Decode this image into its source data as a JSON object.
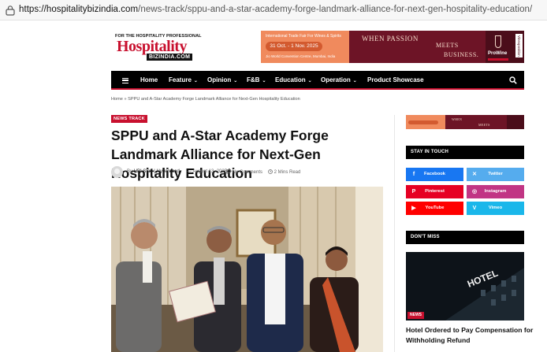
{
  "browser": {
    "url_domain": "https://hospitalitybizindia.com",
    "url_path": "/news-track/sppu-and-a-star-academy-forge-landmark-alliance-for-next-gen-hospitality-education/"
  },
  "header": {
    "logo_tagline": "FOR THE HOSPITALITY PROFESSIONAL",
    "logo_brand": "Hospitality",
    "logo_biz": "BIZINDIA.COM",
    "ad": {
      "event": "International Trade Fair For Wines & Spirits",
      "dates": "31 Oct. - 1 Nov. 2025",
      "venue": "Jio World Convention Centre, Mumbai, India",
      "word1": "WHEN",
      "word2": "PASSION",
      "word3": "MEETS",
      "word4": "BUSINESS.",
      "sponsor": "ProWine",
      "sponsor_region": "Mumbai",
      "vertical": "Vinexposition"
    }
  },
  "nav": {
    "items": [
      {
        "label": "Home",
        "has_menu": false
      },
      {
        "label": "Feature",
        "has_menu": true
      },
      {
        "label": "Opinion",
        "has_menu": true
      },
      {
        "label": "F&B",
        "has_menu": true
      },
      {
        "label": "Education",
        "has_menu": true
      },
      {
        "label": "Operation",
        "has_menu": true
      },
      {
        "label": "Product Showcase",
        "has_menu": false
      }
    ],
    "chevron": "⌄"
  },
  "breadcrumb": "Home » SPPU and A-Star Academy Forge Landmark Alliance for Next-Gen Hospitality Education",
  "article": {
    "category": "NEWS TRACK",
    "title": "SPPU and A-Star Academy Forge Landmark Alliance for Next-Gen Hospitality Education",
    "by_prefix": "By",
    "author": "HBI Staff | Hyderabad",
    "date": "— August 13, 2025",
    "comments": "No Comments",
    "read_time": "2 Mins Read"
  },
  "sidebar": {
    "stay_in_touch": "STAY IN TOUCH",
    "social": [
      {
        "label": "Facebook",
        "icon": "facebook-icon",
        "glyph": "f",
        "color": "#1877f2"
      },
      {
        "label": "Twitter",
        "icon": "twitter-icon",
        "glyph": "✕",
        "color": "#55acee"
      },
      {
        "label": "Pinterest",
        "icon": "pinterest-icon",
        "glyph": "P",
        "color": "#e60023"
      },
      {
        "label": "Instagram",
        "icon": "instagram-icon",
        "glyph": "◎",
        "color": "#c13584"
      },
      {
        "label": "YouTube",
        "icon": "youtube-icon",
        "glyph": "▶",
        "color": "#ff0000"
      },
      {
        "label": "Vimeo",
        "icon": "vimeo-icon",
        "glyph": "V",
        "color": "#1ab7ea"
      }
    ],
    "dont_miss": "DON'T MISS",
    "dont_miss_item": {
      "badge": "NEWS",
      "sign": "HOTEL",
      "title": "Hotel Ordered to Pay Compensation for Withholding Refund"
    }
  },
  "colors": {
    "accent": "#c8102e",
    "nav_bg": "#000000"
  }
}
